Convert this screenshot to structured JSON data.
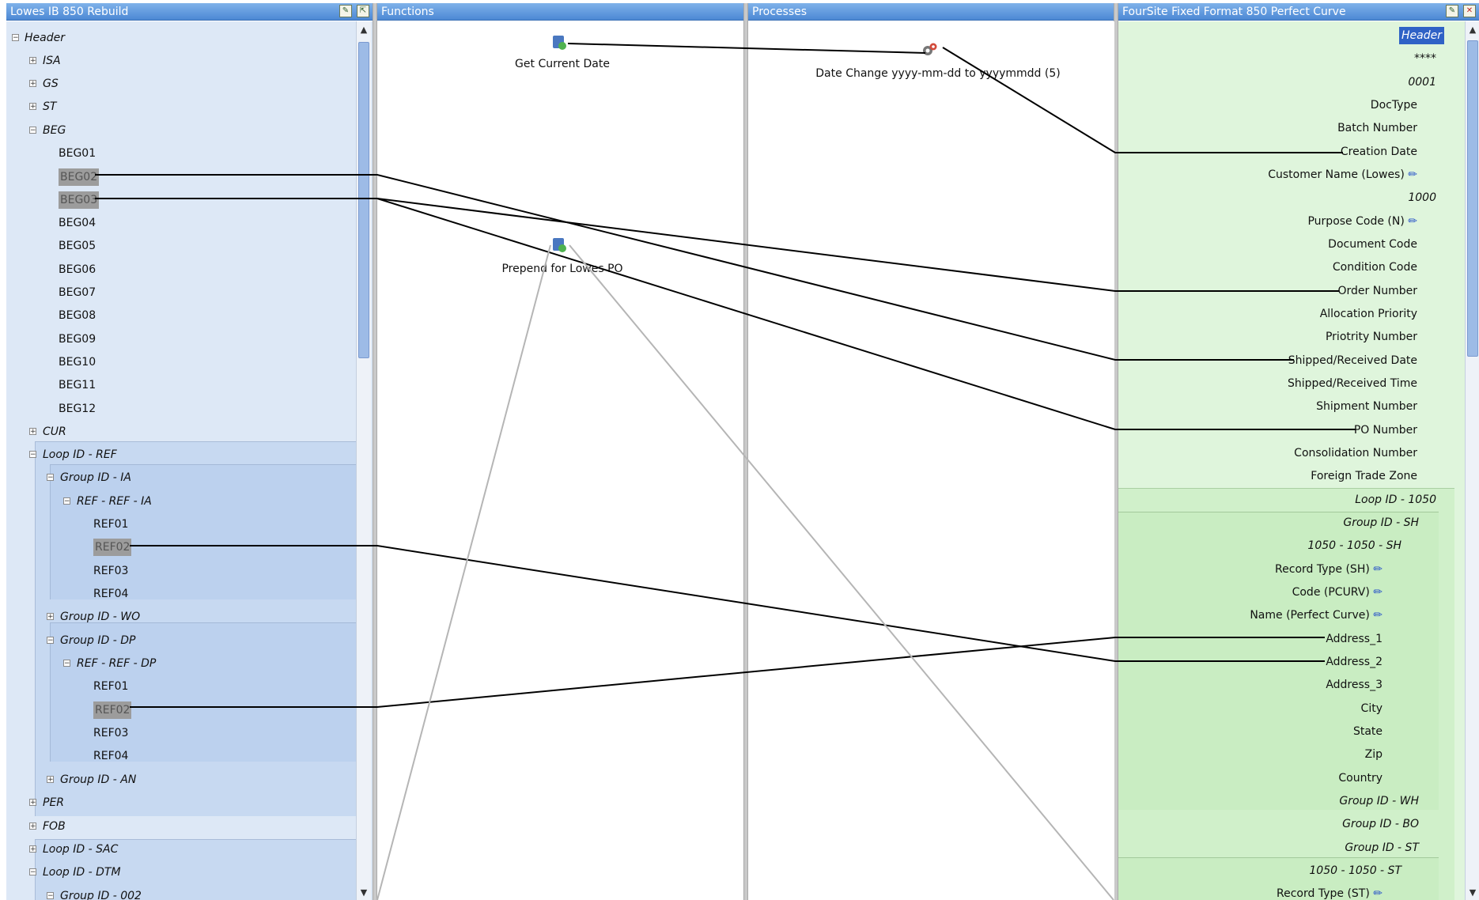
{
  "panels": {
    "source_title": "Lowes IB 850 Rebuild",
    "functions_title": "Functions",
    "processes_title": "Processes",
    "target_title": "FourSite Fixed Format 850 Perfect Curve"
  },
  "source_tree": {
    "header": "Header",
    "isa": "ISA",
    "gs": "GS",
    "st": "ST",
    "beg": "BEG",
    "beg_fields": [
      "BEG01",
      "BEG02",
      "BEG03",
      "BEG04",
      "BEG05",
      "BEG06",
      "BEG07",
      "BEG08",
      "BEG09",
      "BEG10",
      "BEG11",
      "BEG12"
    ],
    "cur": "CUR",
    "loop_ref": "Loop ID - REF",
    "group_ia": "Group ID - IA",
    "ref_ia": "REF - REF - IA",
    "ref_ia_fields": [
      "REF01",
      "REF02",
      "REF03",
      "REF04"
    ],
    "group_wo": "Group ID - WO",
    "group_dp": "Group ID - DP",
    "ref_dp": "REF - REF - DP",
    "ref_dp_fields": [
      "REF01",
      "REF02",
      "REF03",
      "REF04"
    ],
    "group_an": "Group ID - AN",
    "per": "PER",
    "fob": "FOB",
    "loop_sac": "Loop ID - SAC",
    "loop_dtm": "Loop ID - DTM",
    "group_002": "Group ID - 002"
  },
  "functions": {
    "get_current_date": "Get Current Date",
    "prepend": "Prepend for Lowes PO"
  },
  "processes": {
    "date_change": "Date Change yyyy-mm-dd to yyyymmdd (5)"
  },
  "target_tree": {
    "header": "Header",
    "stars": "****",
    "n0001": "0001",
    "rows_a": [
      "DocType",
      "Batch Number",
      "Creation Date",
      "Customer Name (Lowes)"
    ],
    "n1000": "1000",
    "rows_b": [
      "Purpose Code (N)",
      "Document Code",
      "Condition Code",
      "Order Number",
      "Allocation Priority",
      "Priotrity Number",
      "Shipped/Received Date",
      "Shipped/Received Time",
      "Shipment Number",
      "PO Number",
      "Consolidation Number",
      "Foreign Trade Zone"
    ],
    "loop_1050": "Loop ID - 1050",
    "group_sh": "Group ID - SH",
    "seg_sh": "1050 - 1050 - SH",
    "rows_sh": [
      "Record Type (SH)",
      "Code (PCURV)",
      "Name (Perfect Curve)",
      "Address_1",
      "Address_2",
      "Address_3",
      "City",
      "State",
      "Zip",
      "Country"
    ],
    "group_wh": "Group ID - WH",
    "group_bo": "Group ID - BO",
    "group_st": "Group ID - ST",
    "seg_st": "1050 - 1050 - ST",
    "record_type_st": "Record Type (ST)"
  },
  "colors": {
    "title_bar": "#5a93da",
    "source_bg": "#dde8f6",
    "target_bg": "#dff5dc",
    "selected": "#9c9c9c"
  }
}
